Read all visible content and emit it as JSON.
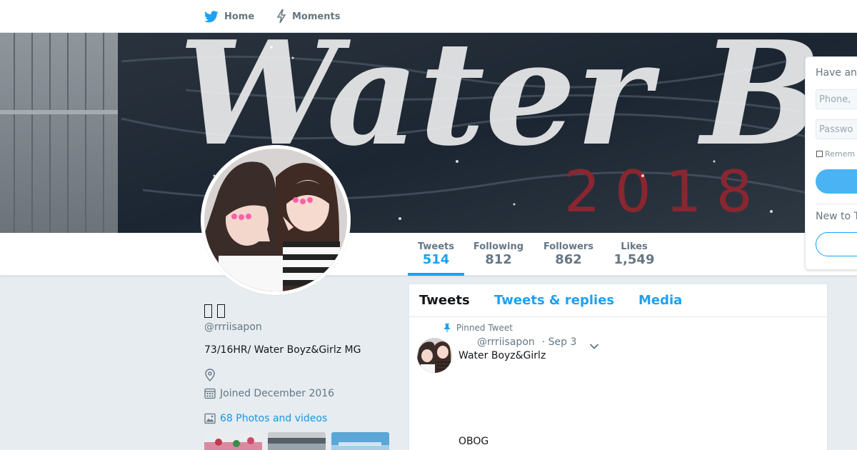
{
  "nav": {
    "home_label": "Home",
    "moments_label": "Moments"
  },
  "colors": {
    "accent": "#1da1f2",
    "link": "#1b95e0",
    "muted": "#657786",
    "background": "#e6ecf0"
  },
  "banner": {
    "text": "Water B",
    "year": "2018"
  },
  "profile_stats": [
    {
      "label": "Tweets",
      "value": "514",
      "active": true
    },
    {
      "label": "Following",
      "value": "812"
    },
    {
      "label": "Followers",
      "value": "862"
    },
    {
      "label": "Likes",
      "value": "1,549"
    }
  ],
  "login_card": {
    "heading": "Have an",
    "phone_placeholder": "Phone,",
    "password_placeholder": "Passwo",
    "remember_label": "Remem",
    "new_heading": "New to T"
  },
  "profile": {
    "handle": "@rrriisapon",
    "bio": "73/16HR/ Water Boyz&Girlz MG",
    "joined": "Joined December 2016",
    "photos_link": "68 Photos and videos"
  },
  "timeline": {
    "tabs": [
      "Tweets",
      "Tweets & replies",
      "Media"
    ],
    "pinned_label": "Pinned Tweet",
    "tweet": {
      "handle": "@rrriisapon",
      "date": "· Sep 3",
      "line1": "Water Boyz&Girlz",
      "line2": "OBOG"
    }
  },
  "icons": {
    "home": "twitter-bird-icon",
    "moments": "lightning-icon",
    "location": "location-pin-icon",
    "calendar": "calendar-icon",
    "photos": "image-icon",
    "pin": "pin-icon",
    "caret": "chevron-down-icon"
  }
}
